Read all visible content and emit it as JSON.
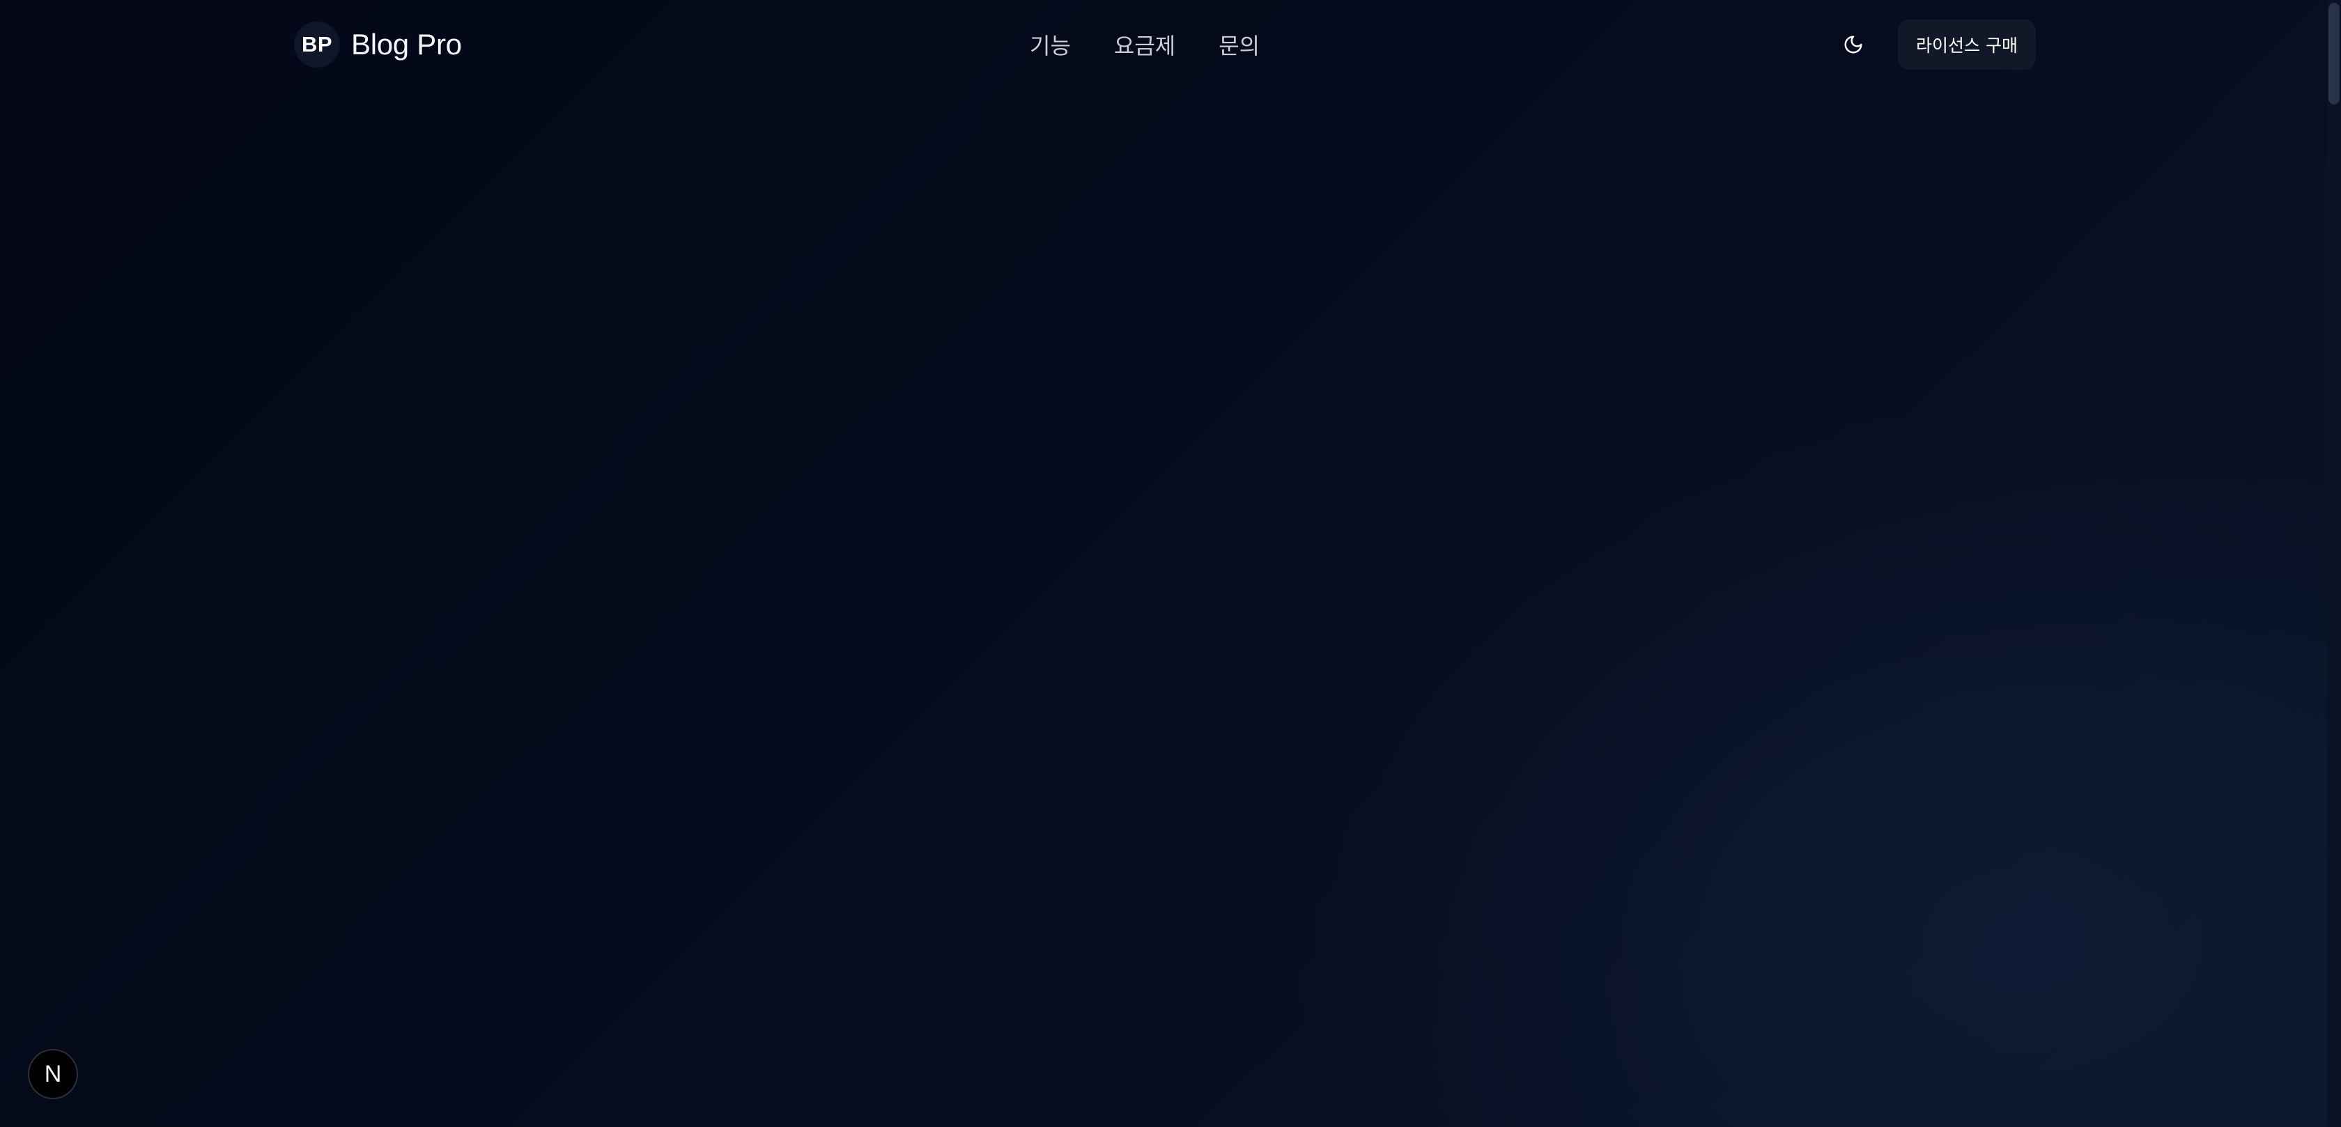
{
  "brand": {
    "badge": "BP",
    "name": "Blog Pro"
  },
  "nav": {
    "items": [
      {
        "label": "기능"
      },
      {
        "label": "요금제"
      },
      {
        "label": "문의"
      }
    ]
  },
  "header": {
    "theme_toggle_icon": "moon-icon",
    "cta_label": "라이선스 구매"
  },
  "dev_indicator": {
    "label": "N",
    "icon": "nextjs-logo-icon"
  },
  "colors": {
    "background_top": "#040818",
    "background_bottom": "#0a1428",
    "cta_background": "#111827",
    "text_primary": "#f4f6fb",
    "text_nav": "#c8cfdc"
  }
}
